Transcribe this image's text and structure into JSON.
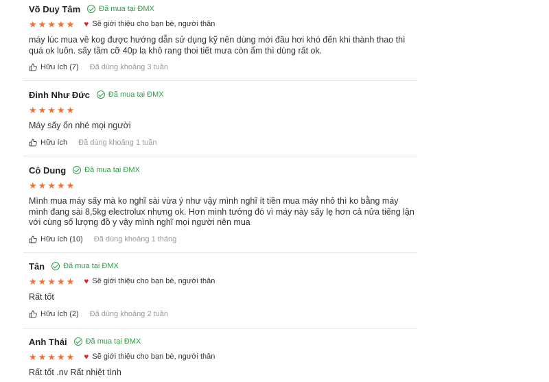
{
  "reviews": [
    {
      "name": "Võ Duy Tâm",
      "bought": "Đã mua tại ĐMX",
      "stars": 5,
      "recommend": "Sẽ giới thiệu cho bạn bè, người thân",
      "content": "máy lúc mua về kog được hướng dẫn sử dụng kỹ nên dùng mới đầu hơi khó đến khi thành thao thì quá ok luôn. sấy tầm cỡ 40p la khô rang thoi tiết mưa còn ẩm thì dùng rất ok.",
      "helpful": "Hữu ích (7)",
      "usage": "Đã dùng khoảng 3 tuần"
    },
    {
      "name": "Đinh Như Đức",
      "bought": "Đã mua tại ĐMX",
      "stars": 5,
      "recommend": "",
      "content": "Máy sấy ổn nhé mọi người",
      "helpful": "Hữu ích",
      "usage": "Đã dùng khoảng 1 tuần"
    },
    {
      "name": "Cô Dung",
      "bought": "Đã mua tại ĐMX",
      "stars": 5,
      "recommend": "",
      "content": "Mình mua máy sấy mà ko nghĩ sài vừa ý như vậy mình nghĩ ít tiền mua máy nhỏ thì ko bằng máy mình đang sài 8,5kg electrolux nhưng ok. Hơn mình tưởng đó vì máy này sấy lẹ hơn cả nửa tiếng lận với cùng số lượng đồ y vậy mình nghĩ mọi người nên mua",
      "helpful": "Hữu ích (10)",
      "usage": "Đã dùng khoảng 1 tháng"
    },
    {
      "name": "Tân",
      "bought": "Đã mua tại ĐMX",
      "stars": 5,
      "recommend": "Sẽ giới thiệu cho bạn bè, người thân",
      "content": "Rất tốt",
      "helpful": "Hữu ích (2)",
      "usage": "Đã dùng khoảng 2 tuần"
    },
    {
      "name": "Anh Thái",
      "bought": "Đã mua tại ĐMX",
      "stars": 5,
      "recommend": "Sẽ giới thiệu cho bạn bè, người thân",
      "content": "Rất tốt .nv Rất nhiệt tình",
      "helpful": "",
      "usage": ""
    }
  ],
  "colors": {
    "star": "#fb6e2e",
    "bought": "#2f9e44",
    "heart": "#e0262f"
  }
}
